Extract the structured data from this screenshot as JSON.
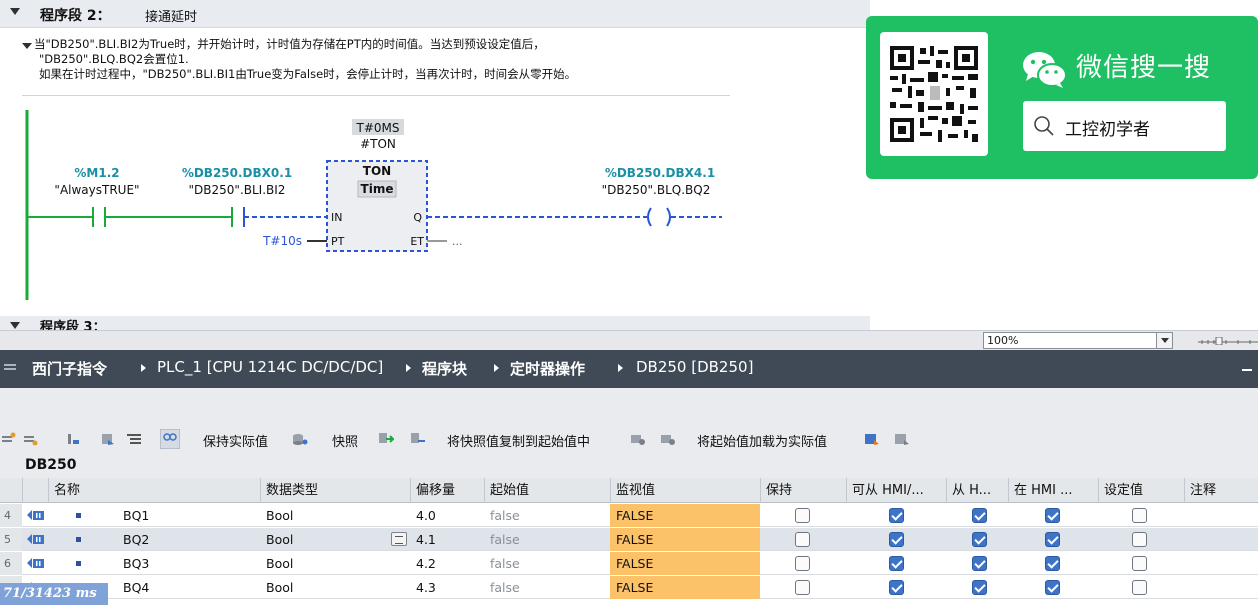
{
  "segment": {
    "title": "程序段 2：",
    "subtitle": "接通延时",
    "comment": [
      "当\"DB250\".BLI.BI2为True时，并开始计时，计时值为存储在PT内的时间值。当达到预设设定值后，",
      "\"DB250\".BLQ.BQ2会置位1.",
      "如果在计时过程中，\"DB250\".BLI.BI1由True变为False时，会停止计时，当再次计时，时间会从零开始。"
    ],
    "next_title": "程序段 3："
  },
  "ladder": {
    "contact1_address": "%M1.2",
    "contact1_name": "\"AlwaysTRUE\"",
    "contact2_address": "%DB250.DBX0.1",
    "contact2_name": "\"DB250\".BLI.BI2",
    "timer_value": "T#0MS",
    "timer_instance": "#TON",
    "timer_type": "TON",
    "timer_subtype": "Time",
    "pin_in": "IN",
    "pin_pt": "PT",
    "pin_q": "Q",
    "pin_et": "ET",
    "pt_value": "T#10s",
    "et_value": "...",
    "coil_address": "%DB250.DBX4.1",
    "coil_name": "\"DB250\".BLQ.BQ2"
  },
  "wechat": {
    "title": "微信搜一搜",
    "search_text": "工控初学者"
  },
  "zoom": {
    "value": "100%"
  },
  "breadcrumb": {
    "items": [
      "西门子指令",
      "PLC_1 [CPU 1214C DC/DC/DC]",
      "程序块",
      "定时器操作",
      "DB250 [DB250]"
    ]
  },
  "toolbar": {
    "keep_actual": "保持实际值",
    "snapshot": "快照",
    "copy_snapshot": "将快照值复制到起始值中",
    "load_start": "将起始值加载为实际值"
  },
  "db": {
    "name": "DB250",
    "columns": [
      "名称",
      "数据类型",
      "偏移量",
      "起始值",
      "监视值",
      "保持",
      "可从 HMI/...",
      "从 H...",
      "在 HMI ...",
      "设定值",
      "注释"
    ],
    "rows": [
      {
        "num": "4",
        "name": "BQ1",
        "type": "Bool",
        "offset": "4.0",
        "start": "false",
        "monitor": "FALSE",
        "retain": false,
        "hmi1": true,
        "hmi2": true,
        "hmi3": true,
        "setpoint": false
      },
      {
        "num": "5",
        "name": "BQ2",
        "type": "Bool",
        "offset": "4.1",
        "start": "false",
        "monitor": "FALSE",
        "retain": false,
        "hmi1": true,
        "hmi2": true,
        "hmi3": true,
        "setpoint": false
      },
      {
        "num": "6",
        "name": "BQ3",
        "type": "Bool",
        "offset": "4.2",
        "start": "false",
        "monitor": "FALSE",
        "retain": false,
        "hmi1": true,
        "hmi2": true,
        "hmi3": true,
        "setpoint": false
      },
      {
        "num": "7",
        "name": "BQ4",
        "type": "Bool",
        "offset": "4.3",
        "start": "false",
        "monitor": "FALSE",
        "retain": false,
        "hmi1": true,
        "hmi2": true,
        "hmi3": true,
        "setpoint": false
      }
    ]
  },
  "timing": "71/31423 ms",
  "colors": {
    "address_teal": "#1b8fa6",
    "monitor_orange": "#fbc26a",
    "wechat_green": "#1fbf63",
    "titlebar": "#404a56",
    "checkbox_blue": "#3d74c7"
  }
}
